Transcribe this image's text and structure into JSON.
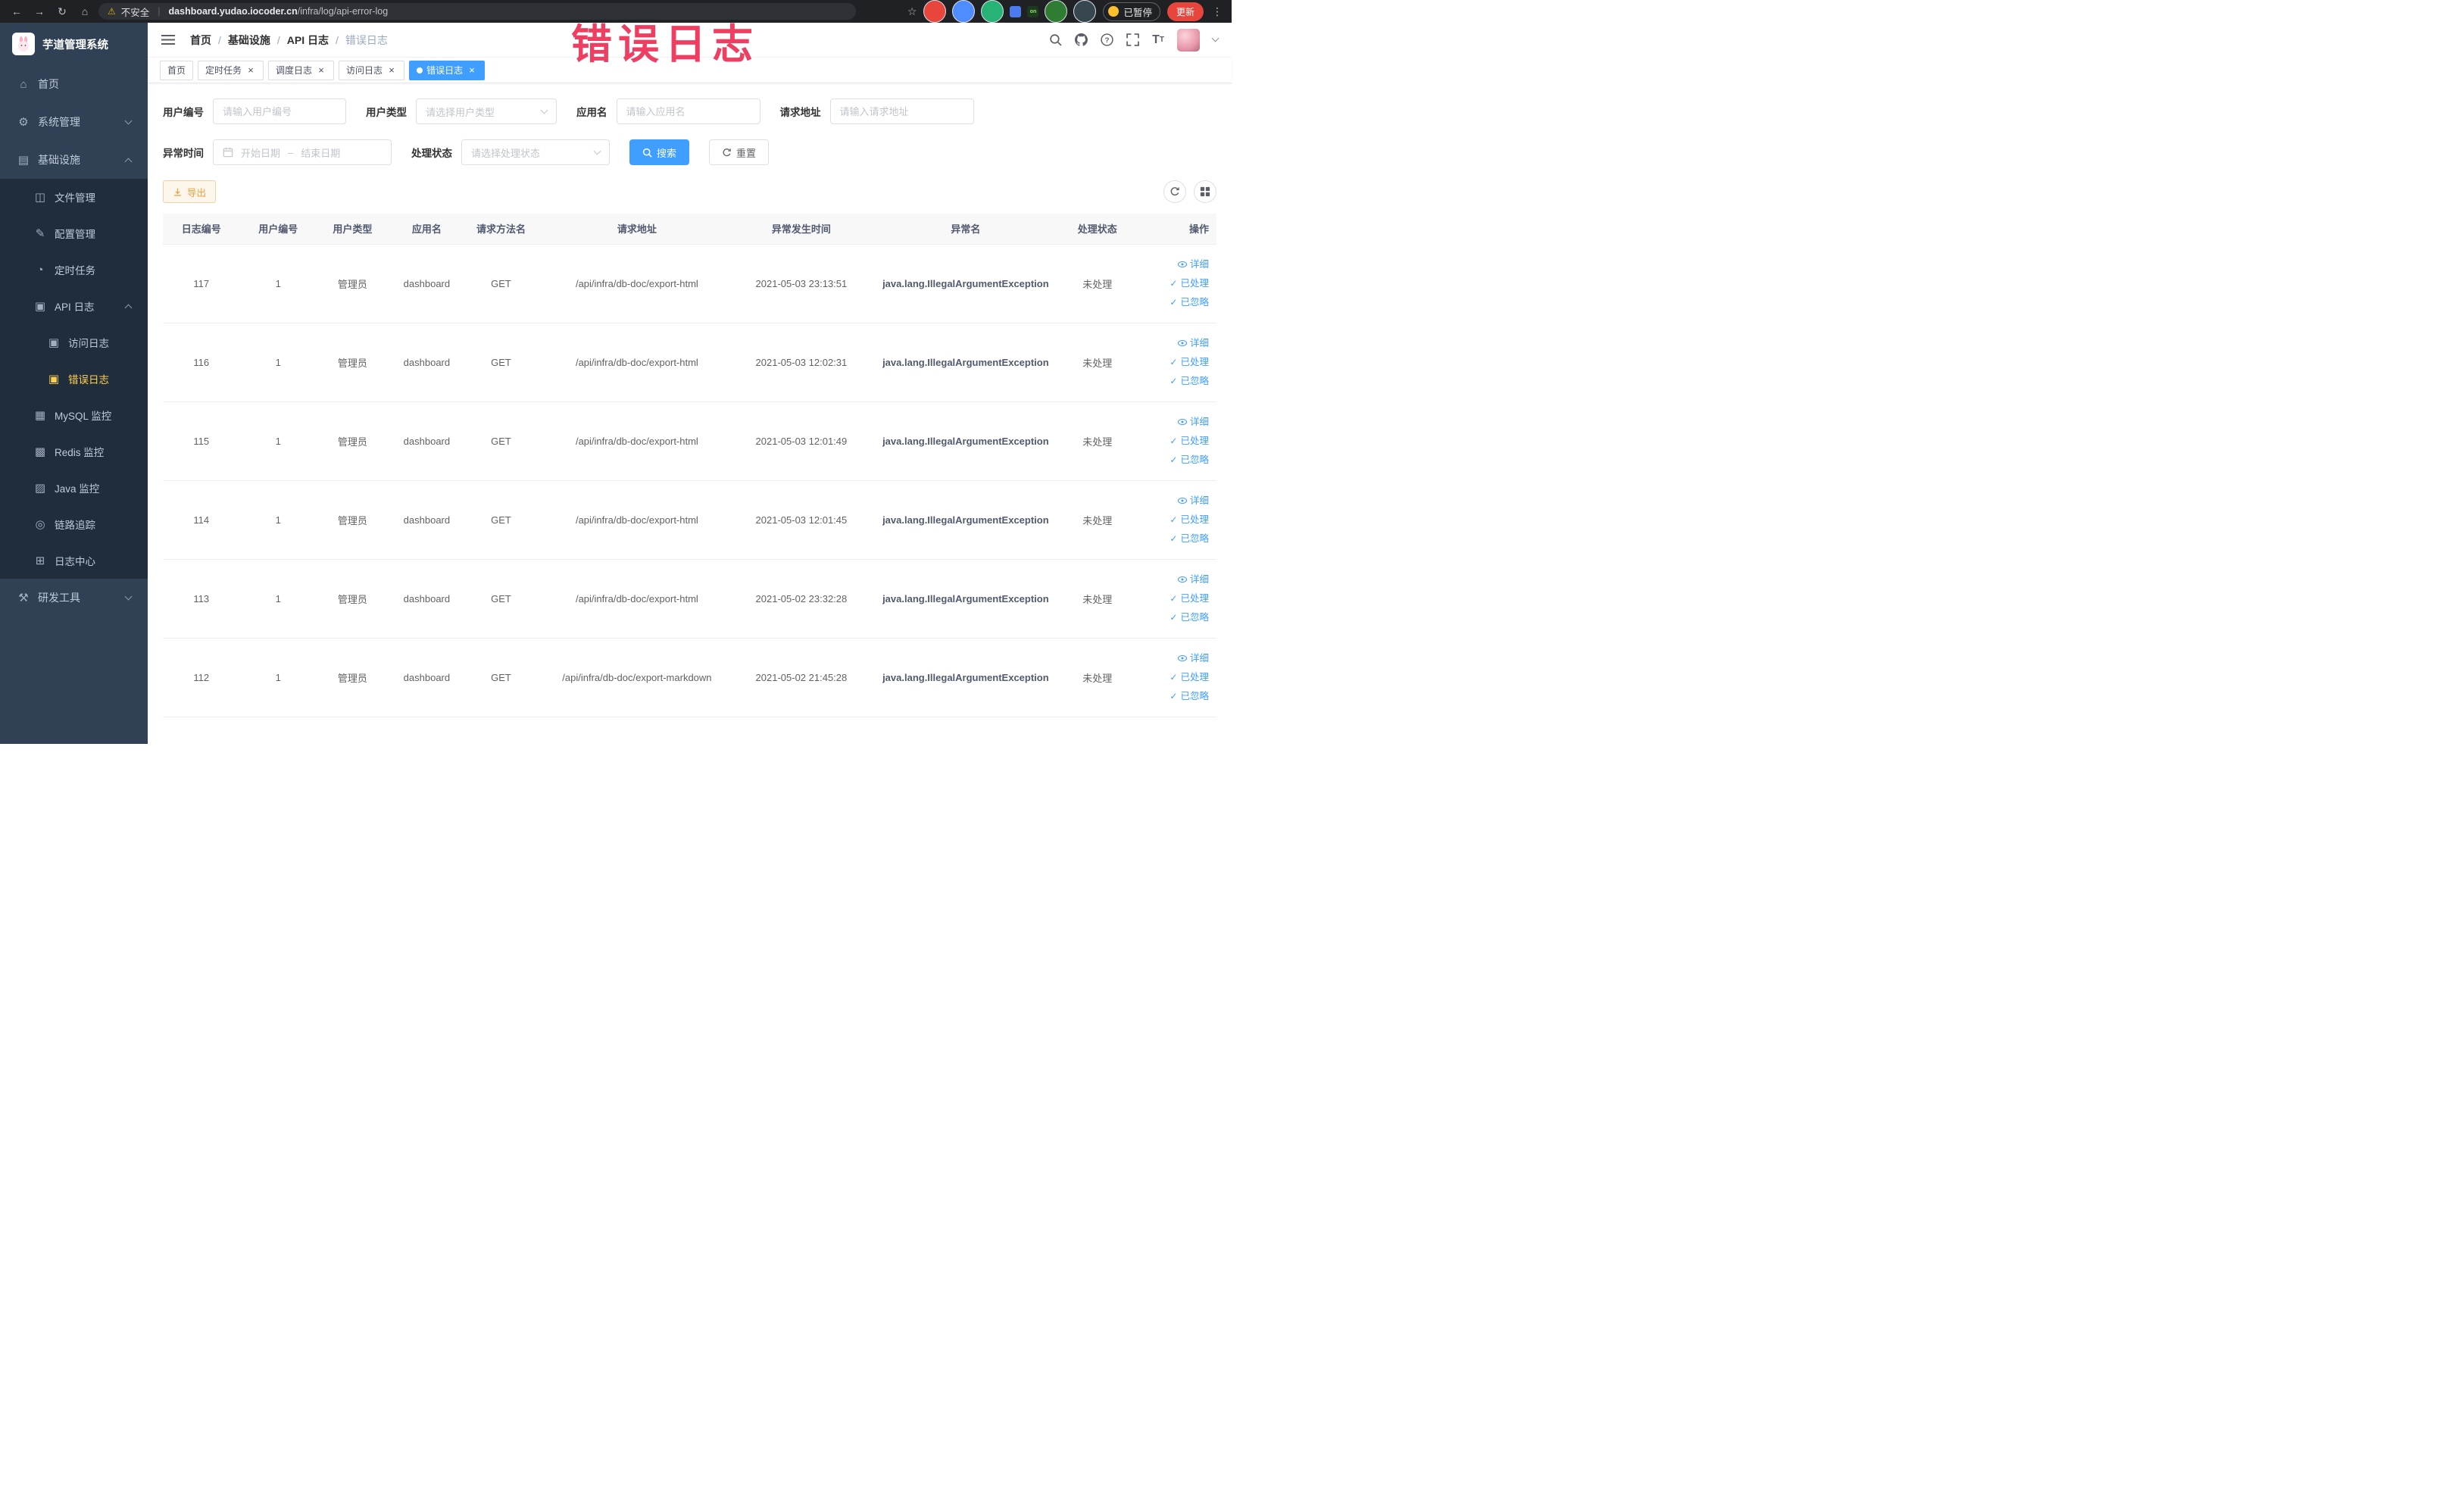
{
  "theme": {
    "primary": "#409eff",
    "warning": "#e6a23c",
    "sidebar-bg": "#304156",
    "submenu-bg": "#1f2d3d",
    "menu-text": "#bfcbd9",
    "menu-active-text": "#ffd04b",
    "watermark-color": "#ee3f63",
    "chrome-bg": "#202124",
    "update-btn-bg": "#e8453c"
  },
  "browser": {
    "security_label": "不安全",
    "url_domain": "dashboard.yudao.iocoder.cn",
    "url_path": "/infra/log/api-error-log",
    "paused_badge": "已暂停",
    "update_label": "更新",
    "extensions": [
      {
        "name": "extension-icon-red",
        "color": "#e8453c",
        "shape": "circle",
        "text": ""
      },
      {
        "name": "extension-icon-blue-drop",
        "color": "#4e8cff",
        "shape": "circle",
        "text": ""
      },
      {
        "name": "extension-icon-green-check",
        "color": "#27b376",
        "shape": "circle",
        "text": ""
      },
      {
        "name": "extension-icon-blue-grid",
        "color": "#4b7bec",
        "shape": "square",
        "text": ""
      },
      {
        "name": "extension-icon-on-badge",
        "color": "#1b3a1f",
        "shape": "square",
        "text": "on"
      },
      {
        "name": "extension-icon-leaf",
        "color": "#2e7d32",
        "shape": "circle",
        "text": ""
      },
      {
        "name": "extension-icon-pin",
        "color": "#37474f",
        "shape": "circle",
        "text": ""
      }
    ]
  },
  "watermark": {
    "text": "错误日志"
  },
  "sidebar": {
    "logo_title": "芋道管理系统",
    "items": [
      {
        "id": "home",
        "label": "首页",
        "level": 1,
        "icon": "home-icon"
      },
      {
        "id": "system",
        "label": "系统管理",
        "level": 1,
        "icon": "gear-icon",
        "arrow": "down"
      },
      {
        "id": "infra",
        "label": "基础设施",
        "level": 1,
        "icon": "grid-icon",
        "arrow": "up"
      },
      {
        "id": "file",
        "label": "文件管理",
        "level": 2,
        "icon": "folder-icon"
      },
      {
        "id": "config",
        "label": "配置管理",
        "level": 2,
        "icon": "edit-icon"
      },
      {
        "id": "job",
        "label": "定时任务",
        "level": 2,
        "icon": "timer-icon"
      },
      {
        "id": "api-log",
        "label": "API 日志",
        "level": 2,
        "icon": "doc-icon",
        "arrow": "up"
      },
      {
        "id": "access-log",
        "label": "访问日志",
        "level": 3,
        "icon": "doc-icon"
      },
      {
        "id": "error-log",
        "label": "错误日志",
        "level": 3,
        "icon": "doc-icon",
        "active": true
      },
      {
        "id": "mysql",
        "label": "MySQL 监控",
        "level": 2,
        "icon": "mysql-icon"
      },
      {
        "id": "redis",
        "label": "Redis 监控",
        "level": 2,
        "icon": "redis-icon"
      },
      {
        "id": "java",
        "label": "Java 监控",
        "level": 2,
        "icon": "java-icon"
      },
      {
        "id": "trace",
        "label": "链路追踪",
        "level": 2,
        "icon": "trace-icon"
      },
      {
        "id": "log-center",
        "label": "日志中心",
        "level": 2,
        "icon": "log-center-icon"
      },
      {
        "id": "devtools",
        "label": "研发工具",
        "level": 1,
        "icon": "tools-icon",
        "arrow": "down"
      }
    ]
  },
  "icon_glyphs": {
    "home-icon": "⌂",
    "gear-icon": "⚙",
    "grid-icon": "▤",
    "folder-icon": "◫",
    "edit-icon": "✎",
    "timer-icon": "◔",
    "doc-icon": "▣",
    "mysql-icon": "▦",
    "redis-icon": "▩",
    "java-icon": "▨",
    "trace-icon": "◎",
    "log-center-icon": "⊞",
    "tools-icon": "⚒"
  },
  "header": {
    "breadcrumb": [
      {
        "label": "首页"
      },
      {
        "label": "基础设施"
      },
      {
        "label": "API 日志"
      },
      {
        "label": "错误日志",
        "current": true
      }
    ]
  },
  "tabs": [
    {
      "id": "home",
      "label": "首页",
      "active": false,
      "closable": false
    },
    {
      "id": "job",
      "label": "定时任务",
      "active": false,
      "closable": true
    },
    {
      "id": "job-log",
      "label": "调度日志",
      "active": false,
      "closable": true
    },
    {
      "id": "access-log",
      "label": "访问日志",
      "active": false,
      "closable": true
    },
    {
      "id": "error-log",
      "label": "错误日志",
      "active": true,
      "closable": true
    }
  ],
  "filters": {
    "user_id": {
      "label": "用户编号",
      "placeholder": "请输入用户编号"
    },
    "user_type": {
      "label": "用户类型",
      "placeholder": "请选择用户类型"
    },
    "app_name": {
      "label": "应用名",
      "placeholder": "请输入应用名"
    },
    "request_url": {
      "label": "请求地址",
      "placeholder": "请输入请求地址"
    },
    "exception_time": {
      "label": "异常时间",
      "start_placeholder": "开始日期",
      "separator": "–",
      "end_placeholder": "结束日期"
    },
    "process_status": {
      "label": "处理状态",
      "placeholder": "请选择处理状态"
    },
    "search_label": "搜索",
    "reset_label": "重置"
  },
  "toolbar": {
    "export_label": "导出"
  },
  "table": {
    "columns": [
      "日志编号",
      "用户编号",
      "用户类型",
      "应用名",
      "请求方法名",
      "请求地址",
      "异常发生时间",
      "异常名",
      "处理状态",
      "操作"
    ],
    "row_actions": [
      {
        "key": "detail",
        "label": "详细",
        "icon": "eye-icon"
      },
      {
        "key": "processed",
        "label": "已处理",
        "icon": "check-icon"
      },
      {
        "key": "ignored",
        "label": "已忽略",
        "icon": "check-icon"
      }
    ],
    "rows": [
      {
        "id": "117",
        "user_id": "1",
        "user_type": "管理员",
        "app_name": "dashboard",
        "method": "GET",
        "url": "/api/infra/db-doc/export-html",
        "time": "2021-05-03 23:13:51",
        "exception": "java.lang.IllegalArgumentException",
        "status": "未处理"
      },
      {
        "id": "116",
        "user_id": "1",
        "user_type": "管理员",
        "app_name": "dashboard",
        "method": "GET",
        "url": "/api/infra/db-doc/export-html",
        "time": "2021-05-03 12:02:31",
        "exception": "java.lang.IllegalArgumentException",
        "status": "未处理"
      },
      {
        "id": "115",
        "user_id": "1",
        "user_type": "管理员",
        "app_name": "dashboard",
        "method": "GET",
        "url": "/api/infra/db-doc/export-html",
        "time": "2021-05-03 12:01:49",
        "exception": "java.lang.IllegalArgumentException",
        "status": "未处理"
      },
      {
        "id": "114",
        "user_id": "1",
        "user_type": "管理员",
        "app_name": "dashboard",
        "method": "GET",
        "url": "/api/infra/db-doc/export-html",
        "time": "2021-05-03 12:01:45",
        "exception": "java.lang.IllegalArgumentException",
        "status": "未处理"
      },
      {
        "id": "113",
        "user_id": "1",
        "user_type": "管理员",
        "app_name": "dashboard",
        "method": "GET",
        "url": "/api/infra/db-doc/export-html",
        "time": "2021-05-02 23:32:28",
        "exception": "java.lang.IllegalArgumentException",
        "status": "未处理"
      },
      {
        "id": "112",
        "user_id": "1",
        "user_type": "管理员",
        "app_name": "dashboard",
        "method": "GET",
        "url": "/api/infra/db-doc/export-markdown",
        "time": "2021-05-02 21:45:28",
        "exception": "java.lang.IllegalArgumentException",
        "status": "未处理"
      }
    ]
  }
}
